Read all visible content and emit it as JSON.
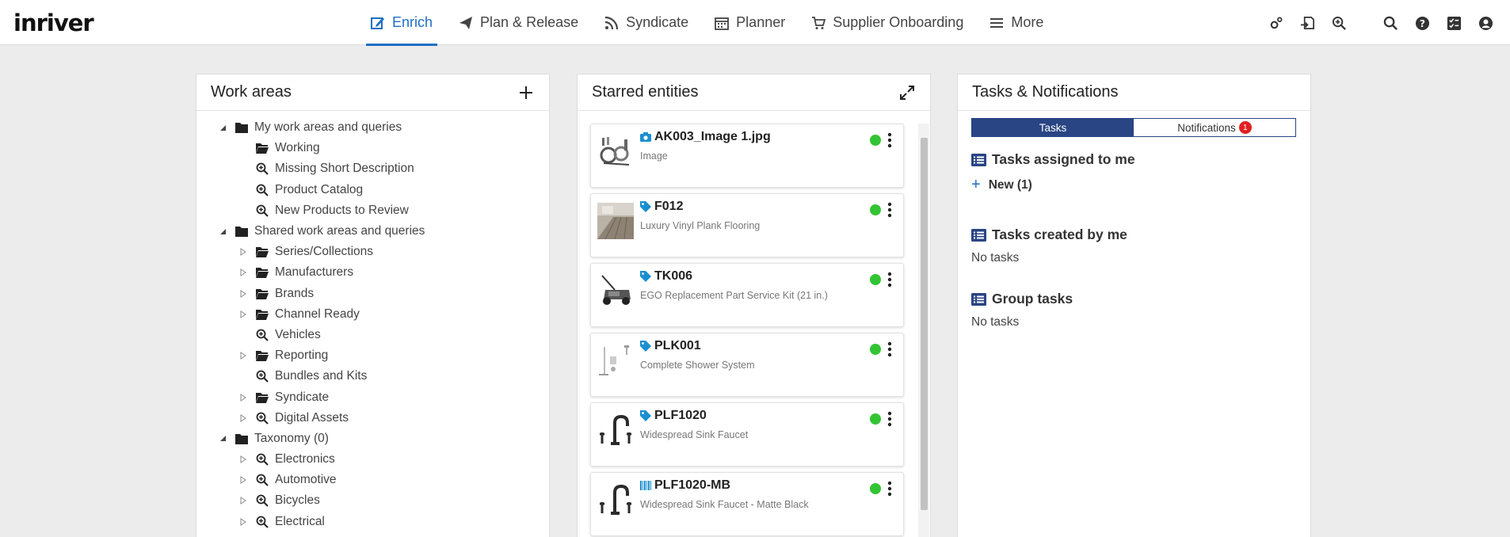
{
  "app": {
    "logo": "inriver"
  },
  "nav": {
    "items": [
      {
        "label": "Enrich",
        "icon": "edit-icon",
        "active": true
      },
      {
        "label": "Plan & Release",
        "icon": "paper-plane-icon",
        "active": false
      },
      {
        "label": "Syndicate",
        "icon": "rss-icon",
        "active": false
      },
      {
        "label": "Planner",
        "icon": "calendar-icon",
        "active": false
      },
      {
        "label": "Supplier Onboarding",
        "icon": "cart-icon",
        "active": false
      },
      {
        "label": "More",
        "icon": "menu-icon",
        "active": false
      }
    ],
    "utility_icons": [
      "settings-icon",
      "import-icon",
      "zoom-in-icon",
      "search-icon",
      "help-icon",
      "tasks-icon",
      "user-icon"
    ]
  },
  "work_areas": {
    "title": "Work areas",
    "add_icon": "plus-icon",
    "tree": [
      {
        "label": "My work areas and queries",
        "level": 0,
        "toggle": "expanded",
        "icon": "folder-icon"
      },
      {
        "label": "Working",
        "level": 1,
        "toggle": "none",
        "icon": "folder-open-icon"
      },
      {
        "label": "Missing Short Description",
        "level": 1,
        "toggle": "none",
        "icon": "query-icon"
      },
      {
        "label": "Product Catalog",
        "level": 1,
        "toggle": "none",
        "icon": "query-icon"
      },
      {
        "label": "New Products to Review",
        "level": 1,
        "toggle": "none",
        "icon": "query-icon"
      },
      {
        "label": "Shared work areas and queries",
        "level": 0,
        "toggle": "expanded",
        "icon": "folder-icon"
      },
      {
        "label": "Series/Collections",
        "level": 1,
        "toggle": "collapsed",
        "icon": "folder-open-icon"
      },
      {
        "label": "Manufacturers",
        "level": 1,
        "toggle": "collapsed",
        "icon": "folder-open-icon"
      },
      {
        "label": "Brands",
        "level": 1,
        "toggle": "collapsed",
        "icon": "folder-open-icon"
      },
      {
        "label": "Channel Ready",
        "level": 1,
        "toggle": "collapsed",
        "icon": "folder-open-icon"
      },
      {
        "label": "Vehicles",
        "level": 1,
        "toggle": "none",
        "icon": "query-icon"
      },
      {
        "label": "Reporting",
        "level": 1,
        "toggle": "collapsed",
        "icon": "folder-open-icon"
      },
      {
        "label": "Bundles and Kits",
        "level": 1,
        "toggle": "none",
        "icon": "query-icon"
      },
      {
        "label": "Syndicate",
        "level": 1,
        "toggle": "collapsed",
        "icon": "folder-open-icon"
      },
      {
        "label": "Digital Assets",
        "level": 1,
        "toggle": "collapsed",
        "icon": "query-icon"
      },
      {
        "label": "Taxonomy (0)",
        "level": 0,
        "toggle": "expanded",
        "icon": "folder-icon"
      },
      {
        "label": "Electronics",
        "level": 1,
        "toggle": "collapsed",
        "icon": "query-icon"
      },
      {
        "label": "Automotive",
        "level": 1,
        "toggle": "collapsed",
        "icon": "query-icon"
      },
      {
        "label": "Bicycles",
        "level": 1,
        "toggle": "collapsed",
        "icon": "query-icon"
      },
      {
        "label": "Electrical",
        "level": 1,
        "toggle": "collapsed",
        "icon": "query-icon"
      }
    ]
  },
  "starred": {
    "title": "Starred entities",
    "expand_icon": "expand-icon",
    "cards": [
      {
        "title": "AK003_Image 1.jpg",
        "subtitle": "Image",
        "type_icon": "camera-icon",
        "thumb": "hose-parts",
        "status_color": "#33c433"
      },
      {
        "title": "F012",
        "subtitle": "Luxury Vinyl Plank Flooring",
        "type_icon": "tag-icon",
        "thumb": "flooring",
        "status_color": "#33c433"
      },
      {
        "title": "TK006",
        "subtitle": "EGO Replacement Part Service Kit (21 in.)",
        "type_icon": "tag-icon",
        "thumb": "lawn-mower",
        "status_color": "#33c433"
      },
      {
        "title": "PLK001",
        "subtitle": "Complete Shower System",
        "type_icon": "tag-icon",
        "thumb": "shower",
        "status_color": "#33c433"
      },
      {
        "title": "PLF1020",
        "subtitle": "Widespread Sink Faucet",
        "type_icon": "tag-icon",
        "thumb": "faucet",
        "status_color": "#33c433"
      },
      {
        "title": "PLF1020-MB",
        "subtitle": "Widespread Sink Faucet - Matte Black",
        "type_icon": "barcode-icon",
        "thumb": "faucet",
        "status_color": "#33c433"
      }
    ]
  },
  "tasks": {
    "title": "Tasks & Notifications",
    "tab_tasks": "Tasks",
    "tab_notifications": "Notifications",
    "notification_count": "1",
    "assigned": {
      "heading": "Tasks assigned to me",
      "new_label": "New (1)"
    },
    "created": {
      "heading": "Tasks created by me",
      "empty": "No tasks"
    },
    "group": {
      "heading": "Group tasks",
      "empty": "No tasks"
    }
  },
  "colors": {
    "accent": "#1f6fc4",
    "tab_active": "#2a4584",
    "status_ok": "#33c433",
    "badge": "#e02020"
  }
}
